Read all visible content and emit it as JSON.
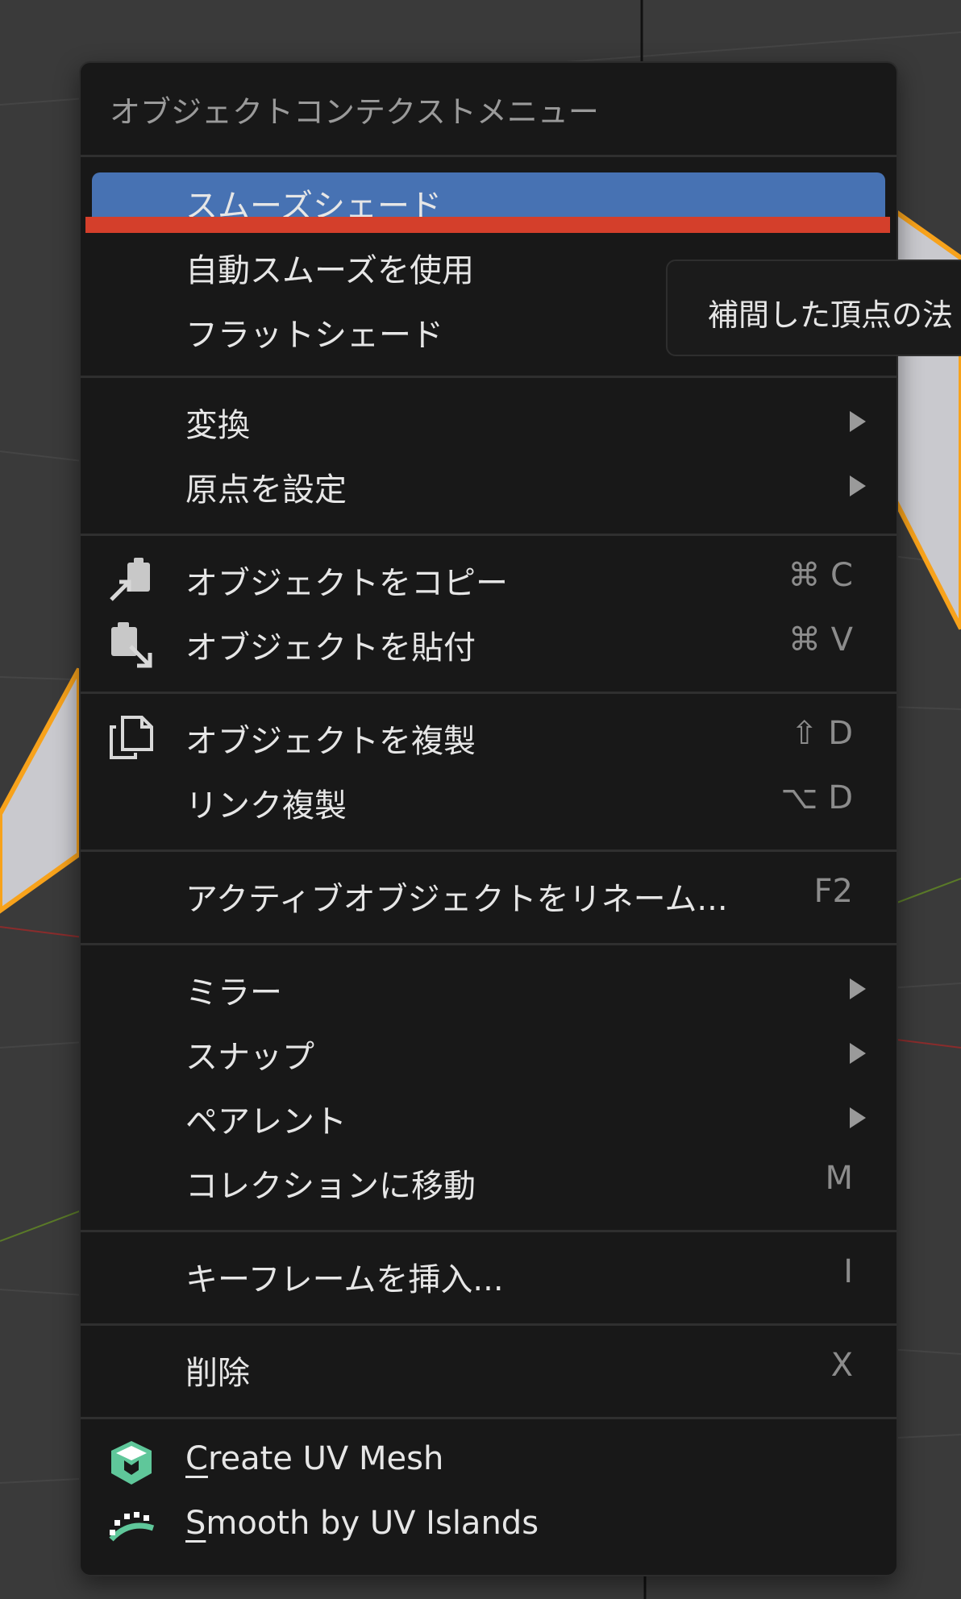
{
  "menu": {
    "title": "オブジェクトコンテクストメニュー",
    "items": [
      {
        "label": "スムーズシェード",
        "shortcut": "",
        "active": true
      },
      {
        "label": "自動スムーズを使用",
        "shortcut": ""
      },
      {
        "label": "フラットシェード",
        "shortcut": ""
      },
      {
        "label": "変換",
        "submenu": true
      },
      {
        "label": "原点を設定",
        "submenu": true
      },
      {
        "label": "オブジェクトをコピー",
        "shortcut": "⌘ C",
        "icon": "copy-to-buffer-icon"
      },
      {
        "label": "オブジェクトを貼付",
        "shortcut": "⌘ V",
        "icon": "paste-from-buffer-icon"
      },
      {
        "label": "オブジェクトを複製",
        "shortcut": "⇧ D",
        "icon": "duplicate-icon"
      },
      {
        "label": "リンク複製",
        "shortcut": "⌥ D"
      },
      {
        "label": "アクティブオブジェクトをリネーム...",
        "shortcut": "F2"
      },
      {
        "label": "ミラー",
        "submenu": true
      },
      {
        "label": "スナップ",
        "submenu": true
      },
      {
        "label": "ペアレント",
        "submenu": true
      },
      {
        "label": "コレクションに移動",
        "shortcut": "M"
      },
      {
        "label": "キーフレームを挿入...",
        "shortcut": "I"
      },
      {
        "label": "削除",
        "shortcut": "X"
      },
      {
        "label_first": "C",
        "label_rest": "reate UV Mesh",
        "icon": "uv-mesh-addon-icon"
      },
      {
        "label_first": "S",
        "label_rest": "mooth by UV Islands",
        "icon": "uv-islands-addon-icon"
      }
    ]
  },
  "tooltip": {
    "text": "補間した頂点の法"
  },
  "colors": {
    "menu_bg": "#181818",
    "active_bg": "#4772b3",
    "highlight": "#d43f2b",
    "selection_outline": "#f7a21b",
    "addon_icon": "#5fc79a"
  }
}
